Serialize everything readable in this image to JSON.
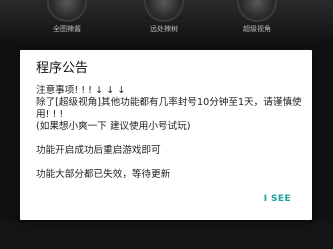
{
  "background": {
    "features": [
      {
        "label": "全图辣酱",
        "icon": "feature-circle-icon"
      },
      {
        "label": "远处辣树",
        "icon": "feature-circle-icon"
      },
      {
        "label": "超级视角",
        "icon": "feature-circle-icon"
      }
    ]
  },
  "dialog": {
    "title": "程序公告",
    "paragraphs": [
      "注意事项! ! ! ↓ ↓ ↓",
      "除了[超级视角]其他功能都有几率封号10分钟至1天，请谨慎使用! ! !",
      "(如果想小爽一下 建议使用小号试玩)",
      "",
      "功能开启成功后重启游戏即可",
      "",
      "功能大部分都已失效，等待更新"
    ],
    "action_label": "I SEE"
  },
  "colors": {
    "accent": "#1aa3a0",
    "dialog_bg": "#ffffff",
    "backdrop": "#111111"
  }
}
